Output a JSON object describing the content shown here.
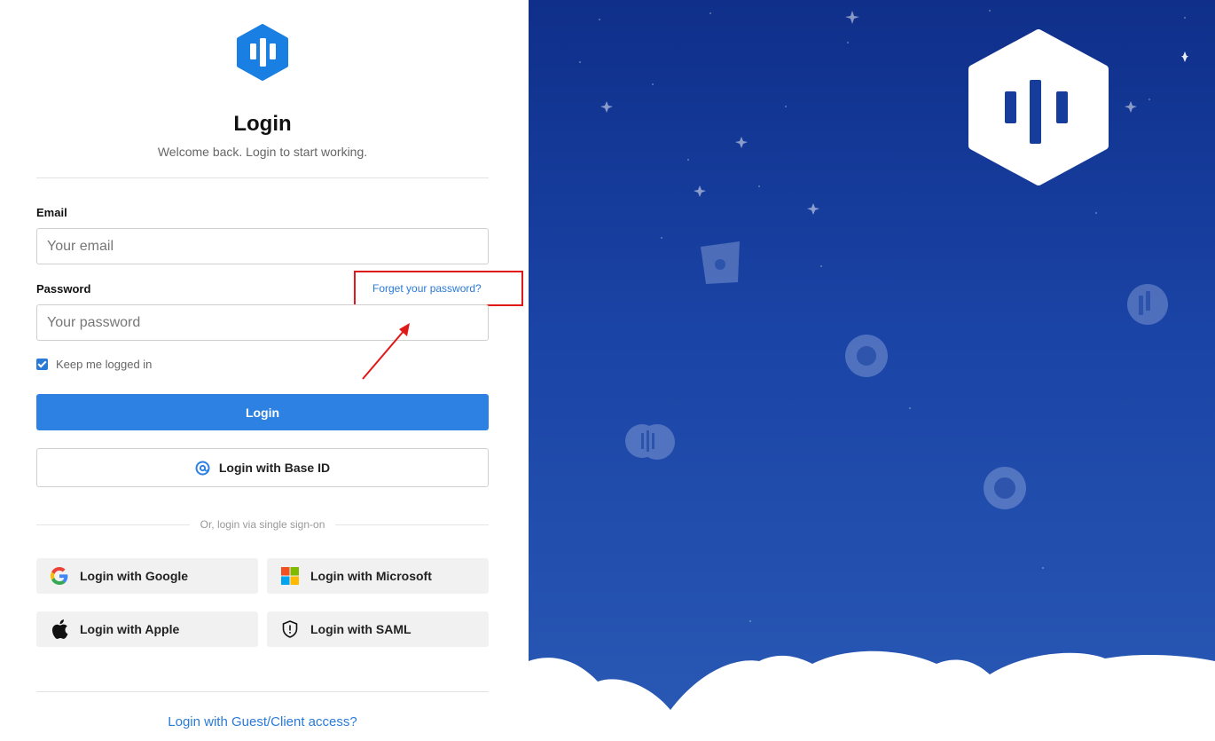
{
  "brand": {
    "accent": "#2c81e2",
    "link": "#2a7ad8",
    "panel_bg": "#1a44a6"
  },
  "login": {
    "title": "Login",
    "subtitle": "Welcome back. Login to start working.",
    "email_label": "Email",
    "email_placeholder": "Your email",
    "password_label": "Password",
    "password_placeholder": "Your password",
    "forgot_link": "Forget your password?",
    "keep_logged_in": "Keep me logged in",
    "keep_logged_in_checked": true,
    "login_button": "Login",
    "base_id_button": "Login with Base ID",
    "sso_divider": "Or, login via single sign-on",
    "guest_link": "Login with Guest/Client access?"
  },
  "sso": [
    {
      "label": "Login with Google",
      "icon": "google-icon"
    },
    {
      "label": "Login with Microsoft",
      "icon": "microsoft-icon"
    },
    {
      "label": "Login with Apple",
      "icon": "apple-icon"
    },
    {
      "label": "Login with SAML",
      "icon": "shield-icon"
    }
  ],
  "annotation": {
    "highlight_color": "#e01818"
  }
}
